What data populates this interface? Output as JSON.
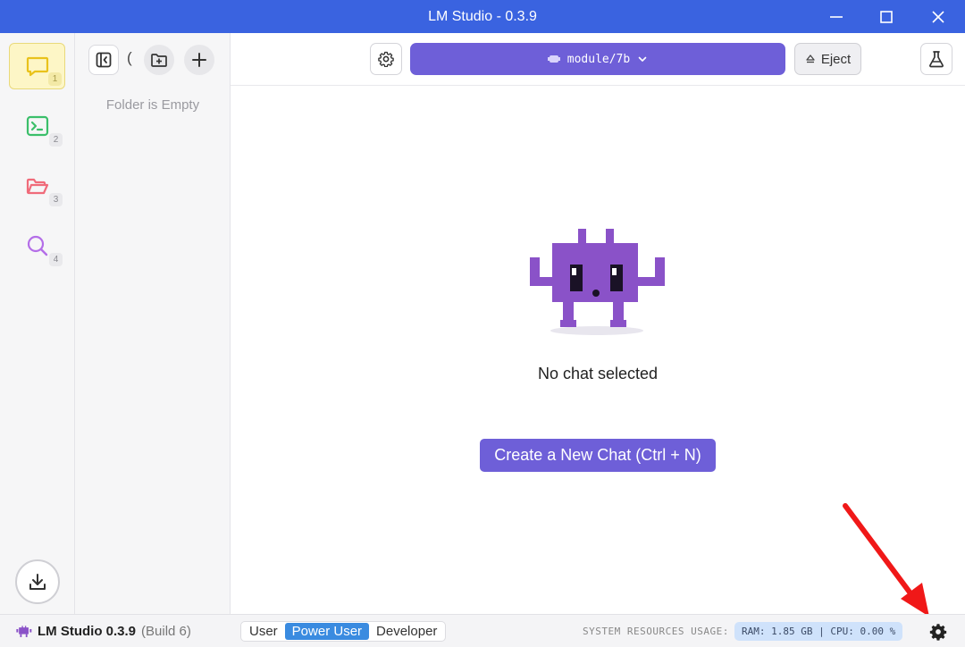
{
  "window": {
    "title": "LM Studio - 0.3.9"
  },
  "leftnav": {
    "items": [
      {
        "number": "1",
        "icon": "chat-bubble-icon",
        "color": "#e9c21b",
        "active": true
      },
      {
        "number": "2",
        "icon": "terminal-icon",
        "color": "#3bbf6a"
      },
      {
        "number": "3",
        "icon": "folder-icon",
        "color": "#f06b7a"
      },
      {
        "number": "4",
        "icon": "search-icon",
        "color": "#b46ee8"
      }
    ]
  },
  "chatpanel": {
    "partial_text": "(",
    "empty_text": "Folder is Empty"
  },
  "toolbar": {
    "model_label": "module/7b",
    "eject_label": "Eject"
  },
  "main": {
    "no_chat_text": "No chat selected",
    "new_chat_label": "Create a New Chat (Ctrl + N)"
  },
  "statusbar": {
    "app_name": "LM Studio 0.3.9",
    "build": "(Build 6)",
    "modes": [
      "User",
      "Power User",
      "Developer"
    ],
    "selected_mode": "Power User",
    "resources_label": "SYSTEM RESOURCES USAGE:",
    "resources_value": "RAM: 1.85 GB  |  CPU: 0.00 %"
  },
  "colors": {
    "titlebar": "#3a63e0",
    "accent": "#6e5fd8",
    "mode_selected": "#3a8be0",
    "arrow": "#f01818"
  }
}
